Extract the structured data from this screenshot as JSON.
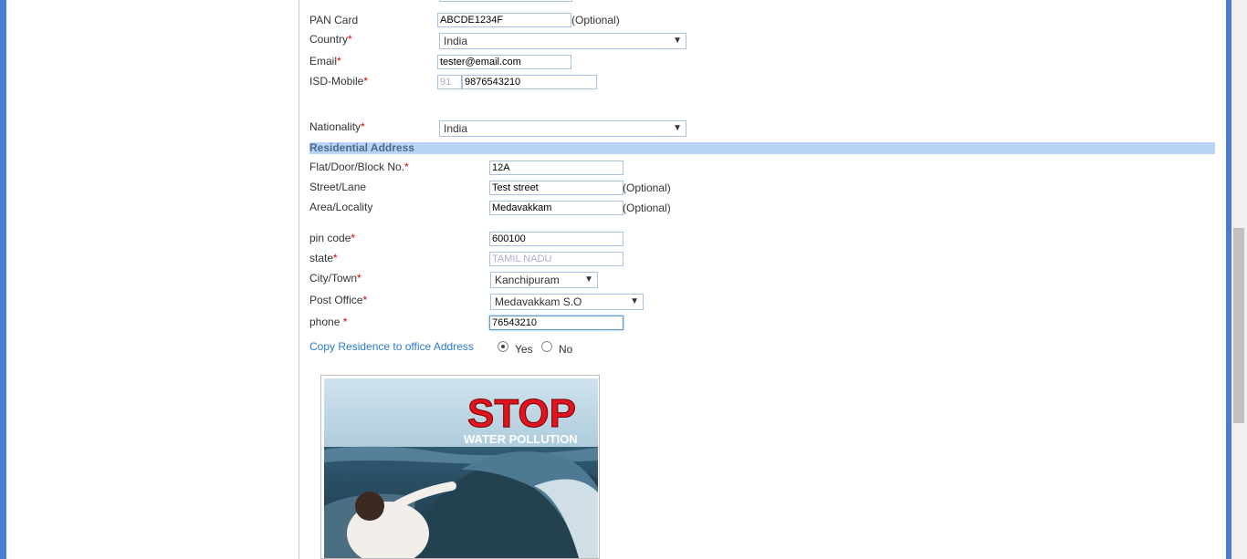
{
  "form": {
    "pan_label": "PAN Card",
    "pan_value": "ABCDE1234F",
    "optional_text": "(Optional)",
    "country_label": "Country",
    "country_value": "India",
    "email_label": "Email",
    "email_value": "tester@email.com",
    "isd_mobile_label": "ISD-Mobile",
    "isd_value": "91",
    "mobile_value": "9876543210",
    "nationality_label": "Nationality",
    "nationality_value": "India",
    "required_mark": "*"
  },
  "residential": {
    "section_title": "Residential Address",
    "flat_label": "Flat/Door/Block No.",
    "flat_value": "12A",
    "street_label": "Street/Lane",
    "street_value": "Test street",
    "area_label": "Area/Locality",
    "area_value": "Medavakkam",
    "pin_label": "pin code",
    "pin_value": "600100",
    "state_label": "state",
    "state_value": "TAMIL NADU",
    "city_label": "City/Town",
    "city_value": "Kanchipuram",
    "post_office_label": "Post Office",
    "post_office_value": "Medavakkam S.O",
    "phone_label": "phone",
    "phone_value": "76543210",
    "copy_label": "Copy Residence to office Address",
    "yes_label": "Yes",
    "no_label": "No",
    "copy_selected": "Yes"
  },
  "poster": {
    "headline": "STOP",
    "subline": "WATER POLLUTION"
  },
  "colors": {
    "accent_blue": "#4a7bd5",
    "section_bar": "#b9d3f7",
    "link": "#2a7bd3",
    "required": "#dd0000",
    "poster_red": "#e0141e"
  },
  "icons": {
    "dropdown": "chevron-down-icon",
    "radio": "radio-icon"
  }
}
